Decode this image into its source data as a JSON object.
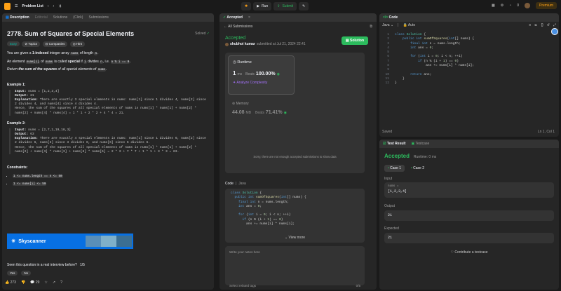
{
  "topbar": {
    "problem_list": "Problem List",
    "run": "Run",
    "submit": "Submit",
    "premium": "Premium",
    "notif_count": "0"
  },
  "description": {
    "tabs": [
      "Description",
      "Editorial",
      "Solutions",
      "(Click)",
      "Submissions"
    ],
    "title": "2778. Sum of Squares of Special Elements",
    "solved": "Solved",
    "tags": [
      "Easy",
      "Topics",
      "Companies",
      "Hint"
    ],
    "p1_a": "You are given a",
    "p1_b": "1-indexed",
    "p1_c": "integer array",
    "p1_code": "nums",
    "p1_d": "of length",
    "p1_e": "n",
    "p2_a": "An element",
    "p2_code1": "nums[i]",
    "p2_b": "of",
    "p2_code2": "nums",
    "p2_c": "is called",
    "p2_d": "special",
    "p2_e": "if",
    "p2_code3": "i",
    "p2_f": "divides",
    "p2_code4": "n",
    "p2_g": ", i.e.",
    "p2_code5": "n % i == 0",
    "p3_a": "Return",
    "p3_b": "the sum of the squares",
    "p3_c": "of all special elements of",
    "p3_code": "nums",
    "ex1_label": "Example 1:",
    "ex1_input_k": "Input:",
    "ex1_input_v": " nums = [1,2,3,4]",
    "ex1_output_k": "Output:",
    "ex1_output_v": " 21",
    "ex1_expl_k": "Explanation:",
    "ex1_expl_v": " There are exactly 3 special elements in nums: nums[1] since 1 divides 4, nums[2] since 2 divides 4, and nums[4] since 4 divides 4.\nHence, the sum of the squares of all special elements of nums is nums[1] * nums[1] + nums[2] * nums[2] + nums[4] * nums[4] = 1 * 1 + 2 * 2 + 4 * 4 = 21.",
    "ex2_label": "Example 2:",
    "ex2_input_k": "Input:",
    "ex2_input_v": " nums = [2,7,1,19,18,3]",
    "ex2_output_k": "Output:",
    "ex2_output_v": " 63",
    "ex2_expl_k": "Explanation:",
    "ex2_expl_v": " There are exactly 4 special elements in nums: nums[1] since 1 divides 6, nums[2] since 2 divides 6, nums[3] since 3 divides 6, and nums[6] since 6 divides 6.\nHence, the sum of the squares of all special elements of nums is nums[1] * nums[1] + nums[2] * nums[2] + nums[3] * nums[3] + nums[6] * nums[6] = 2 * 2 + 7 * 7 + 1 * 1 + 3 * 3 = 63.",
    "constraints_label": "Constraints:",
    "constraint1": "1 <= nums.length == n <= 50",
    "constraint2": "1 <= nums[i] <= 50",
    "ad_text": "Skyscanner",
    "interview_q": "Seen this question in a real interview before?",
    "interview_count": "1/5",
    "yes": "Yes",
    "no": "No",
    "likes": "273",
    "comments": "29"
  },
  "accepted": {
    "tab": "Accepted",
    "all_submissions": "All Submissions",
    "status": "Accepted",
    "submitter": "shubhoi kumar",
    "submitted_at": "submitted at Jul 21, 2024 22:41",
    "solution_btn": "Solution",
    "runtime_label": "Runtime",
    "runtime_value": "1",
    "runtime_unit": "ms",
    "beats_label": "Beats",
    "beats_value": "100.00%",
    "analyze": "Analyze Complexity",
    "memory_label": "Memory",
    "memory_value": "44.08",
    "memory_unit": "MB",
    "memory_beats_label": "Beats",
    "memory_beats_value": "71.41%",
    "not_enough": "Sorry, there are not enough accepted submissions to show data",
    "code_label": "Code",
    "code_lang": "Java",
    "view_more": "View more",
    "notes_placeholder": "Write your notes here",
    "related_tags": "Select related tags",
    "notes_count": "0/5"
  },
  "editor": {
    "title": "Code",
    "lang": "Java",
    "auto": "Auto",
    "saved": "Saved",
    "cursor": "Ln 1, Col 1",
    "lines": [
      "class Solution {",
      "    public int sumOfSquares(int[] nums) {",
      "        final int n = nums.length;",
      "        int ans = 0;",
      "",
      "        for (int i = 0; i < n; ++i)",
      "            if (n % (i + 1) == 0)",
      "                ans += nums[i] * nums[i];",
      "",
      "        return ans;",
      "    }",
      "}"
    ]
  },
  "testresult": {
    "tab1": "Test Result",
    "tab2": "Testcase",
    "status": "Accepted",
    "runtime": "Runtime: 0 ms",
    "case1": "Case 1",
    "case2": "Case 2",
    "input_label": "Input",
    "input_var": "nums =",
    "input_val": "[1,2,3,4]",
    "output_label": "Output",
    "output_val": "21",
    "expected_label": "Expected",
    "expected_val": "21",
    "contribute": "Contribute a testcase"
  }
}
